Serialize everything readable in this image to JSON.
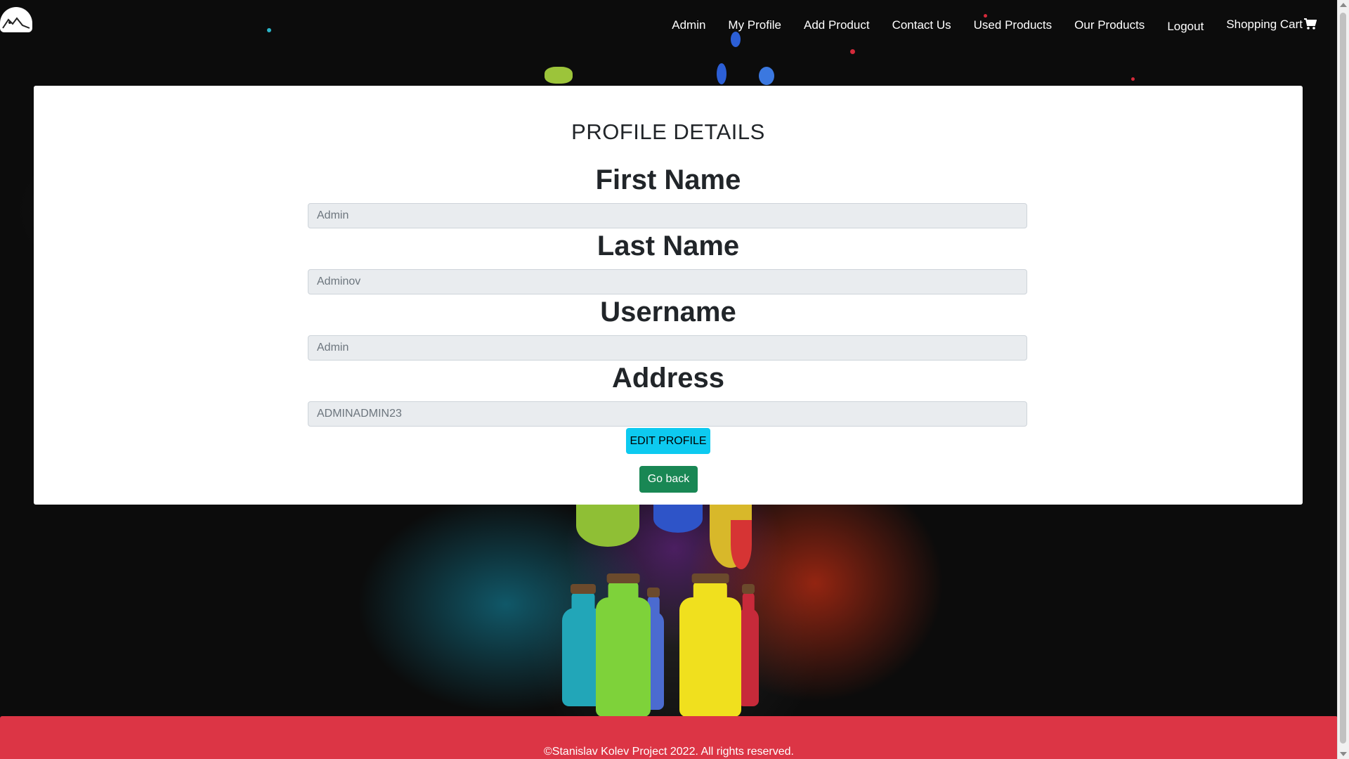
{
  "navbar": {
    "links": [
      {
        "label": "Admin"
      },
      {
        "label": "My Profile"
      },
      {
        "label": "Add Product"
      },
      {
        "label": "Contact Us"
      },
      {
        "label": "Used Products"
      },
      {
        "label": "Our Products"
      },
      {
        "label": "Logout"
      },
      {
        "label": "Shopping Cart"
      }
    ],
    "cart_icon": "shopping-cart-icon",
    "logo_icon": "site-logo-icon"
  },
  "profile": {
    "title": "PROFILE DETAILS",
    "fields": [
      {
        "label": "First Name",
        "value": "Admin"
      },
      {
        "label": "Last Name",
        "value": "Adminov"
      },
      {
        "label": "Username",
        "value": "Admin"
      },
      {
        "label": "Address",
        "value": "ADMINADMIN23"
      }
    ],
    "edit_button": "EDIT PROFILE",
    "back_button": "Go back"
  },
  "footer": {
    "text": "©Stanislav Kolev Project 2022. All rights reserved."
  },
  "colors": {
    "edit_button": "#0dcaf0",
    "back_button": "#198754",
    "footer": "#dc3545",
    "input_bg": "#e9ecef"
  }
}
